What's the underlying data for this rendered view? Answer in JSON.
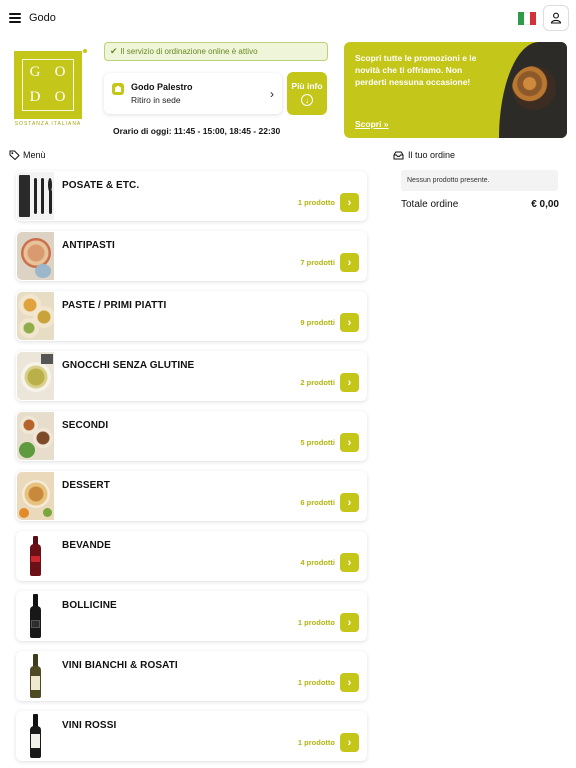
{
  "header": {
    "title": "Godo",
    "flag_icon": "italy-flag-icon",
    "user_icon": "user-icon"
  },
  "logo": {
    "letters": [
      "G",
      "O",
      "D",
      "O"
    ],
    "tagline": "SOSTANZA ITALIANA"
  },
  "store": {
    "status_text": "Il servizio di ordinazione online è attivo",
    "name": "Godo Palestro",
    "mode": "Ritiro in sede",
    "info_label": "Più info",
    "hours": "Orario di oggi: 11:45 - 15:00, 18:45 - 22:30"
  },
  "promo": {
    "text": "Scopri tutte le promozioni e le novità che ti offriamo. Non perderti nessuna occasione!",
    "link_label": "Scopri »"
  },
  "menu": {
    "heading": "Menù",
    "categories": [
      {
        "name": "POSATE & ETC.",
        "count": "1 prodotto"
      },
      {
        "name": "ANTIPASTI",
        "count": "7 prodotti"
      },
      {
        "name": "PASTE / PRIMI PIATTI",
        "count": "9 prodotti"
      },
      {
        "name": "GNOCCHI SENZA GLUTINE",
        "count": "2 prodotti"
      },
      {
        "name": "SECONDI",
        "count": "5 prodotti"
      },
      {
        "name": "DESSERT",
        "count": "6 prodotti"
      },
      {
        "name": "BEVANDE",
        "count": "4 prodotti"
      },
      {
        "name": "BOLLICINE",
        "count": "1 prodotto"
      },
      {
        "name": "VINI BIANCHI & ROSATI",
        "count": "1 prodotto"
      },
      {
        "name": "VINI ROSSI",
        "count": "1 prodotto"
      }
    ]
  },
  "order": {
    "heading": "Il tuo ordine",
    "empty_text": "Nessun prodotto presente.",
    "total_label": "Totale ordine",
    "total_value": "€ 0,00"
  },
  "colors": {
    "accent": "#c5c61a",
    "status_bg": "#eef5d9",
    "status_text": "#6b8a1f"
  }
}
